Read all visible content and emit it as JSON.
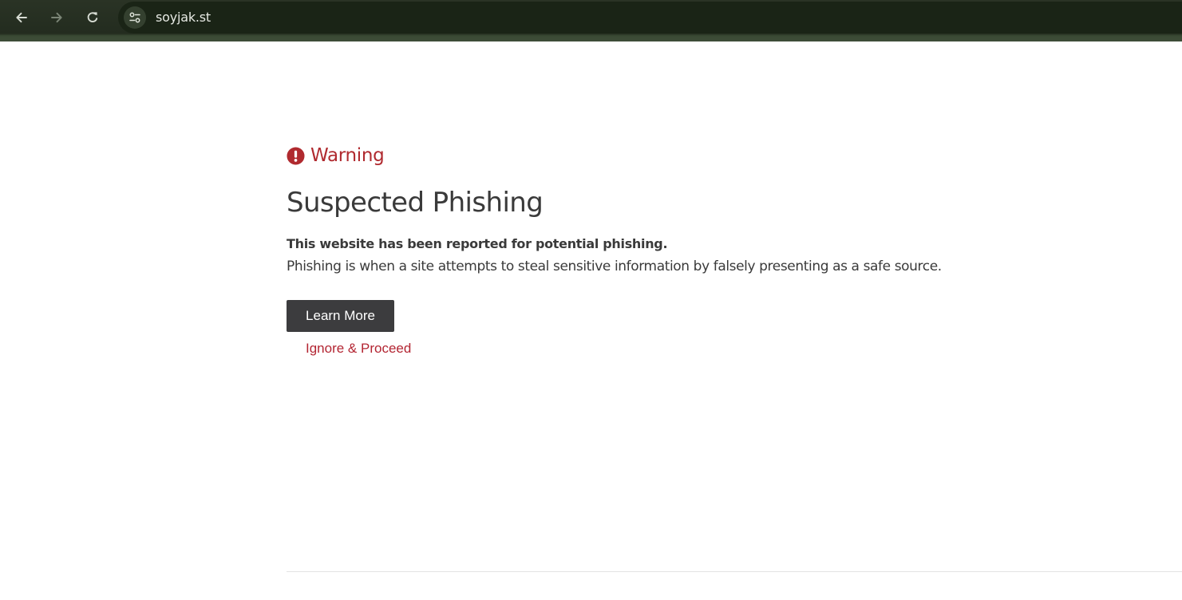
{
  "browser": {
    "url": "soyjak.st",
    "icons": {
      "back": "arrow-left-icon",
      "forward": "arrow-right-icon",
      "reload": "reload-icon",
      "site_info": "tune-icon"
    }
  },
  "page": {
    "warning_label": "Warning",
    "title": "Suspected Phishing",
    "description_strong": "This website has been reported for potential phishing.",
    "description": "Phishing is when a site attempts to steal sensitive information by falsely presenting as a safe source.",
    "learn_more_label": "Learn More",
    "ignore_label": "Ignore & Proceed",
    "warning_icon": "exclamation-circle-icon"
  },
  "colors": {
    "toolbar": "#232c1f",
    "omnibox": "#1a2416",
    "warning_red": "#b02a2f",
    "link_red": "#b32532",
    "button_dark": "#3c3c3e",
    "text_dark": "#3a3a3a"
  }
}
